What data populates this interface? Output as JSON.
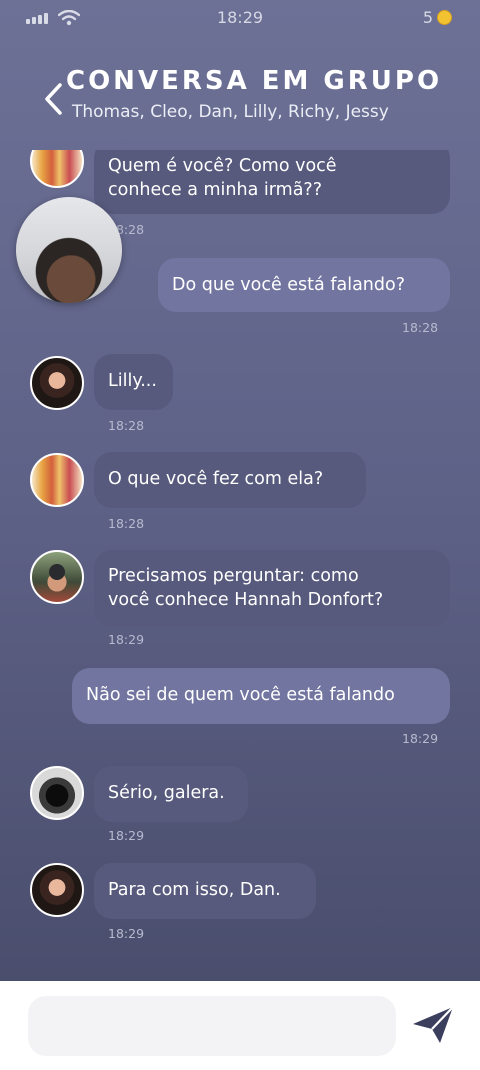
{
  "status": {
    "time": "18:29",
    "coins": "5"
  },
  "header": {
    "title": "CONVERSA EM GRUPO",
    "participants": "Thomas, Cleo, Dan, Lilly, Richy, Jessy"
  },
  "messages": [
    {
      "text_l1": "Quem é você? Como você",
      "text_l2": "conhece a minha irmã??",
      "time": "18:28"
    },
    {
      "text": "Do que você está falando?",
      "time": "18:28"
    },
    {
      "text": "Lilly...",
      "time": "18:28"
    },
    {
      "text": "O que você fez com ela?",
      "time": "18:28"
    },
    {
      "text_l1": "Precisamos perguntar: como",
      "text_l2": "você conhece Hannah Donfort?",
      "time": "18:29"
    },
    {
      "text": "Não sei de quem você está falando",
      "time": "18:29"
    },
    {
      "text": "Sério, galera.",
      "time": "18:29"
    },
    {
      "text": "Para com isso, Dan.",
      "time": "18:29"
    }
  ],
  "composer": {
    "placeholder": ""
  },
  "icons": {
    "signal": "signal-icon",
    "wifi": "wifi-icon",
    "coin": "coin-icon",
    "back": "back-chevron-icon",
    "send": "send-icon"
  }
}
